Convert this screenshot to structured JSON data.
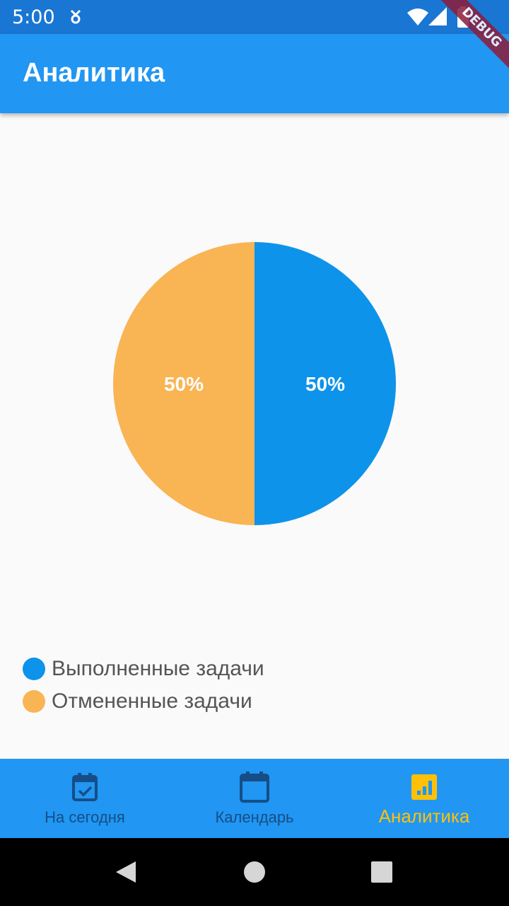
{
  "status_bar": {
    "time": "5:00"
  },
  "debug_banner": "DEBUG",
  "app_bar": {
    "title": "Аналитика"
  },
  "chart_data": {
    "type": "pie",
    "values": [
      50,
      50
    ],
    "labels": [
      "50%",
      "50%"
    ],
    "categories": [
      "Выполненные задачи",
      "Отмененные задачи"
    ],
    "colors": [
      "#0d93ea",
      "#f9b454"
    ]
  },
  "legend": {
    "items": [
      {
        "label": "Выполненные задачи",
        "color": "#0d93ea"
      },
      {
        "label": "Отмененные задачи",
        "color": "#f9b454"
      }
    ]
  },
  "bottom_nav": {
    "items": [
      {
        "label": "На сегодня",
        "icon": "calendar-check-icon",
        "active": false
      },
      {
        "label": "Календарь",
        "icon": "calendar-icon",
        "active": false
      },
      {
        "label": "Аналитика",
        "icon": "analytics-icon",
        "active": true
      }
    ],
    "active_color": "#ffc107",
    "inactive_color": "#154e86"
  },
  "colors": {
    "status_bar": "#1976d2",
    "app_bar": "#2196f3",
    "background": "#fafafa"
  }
}
